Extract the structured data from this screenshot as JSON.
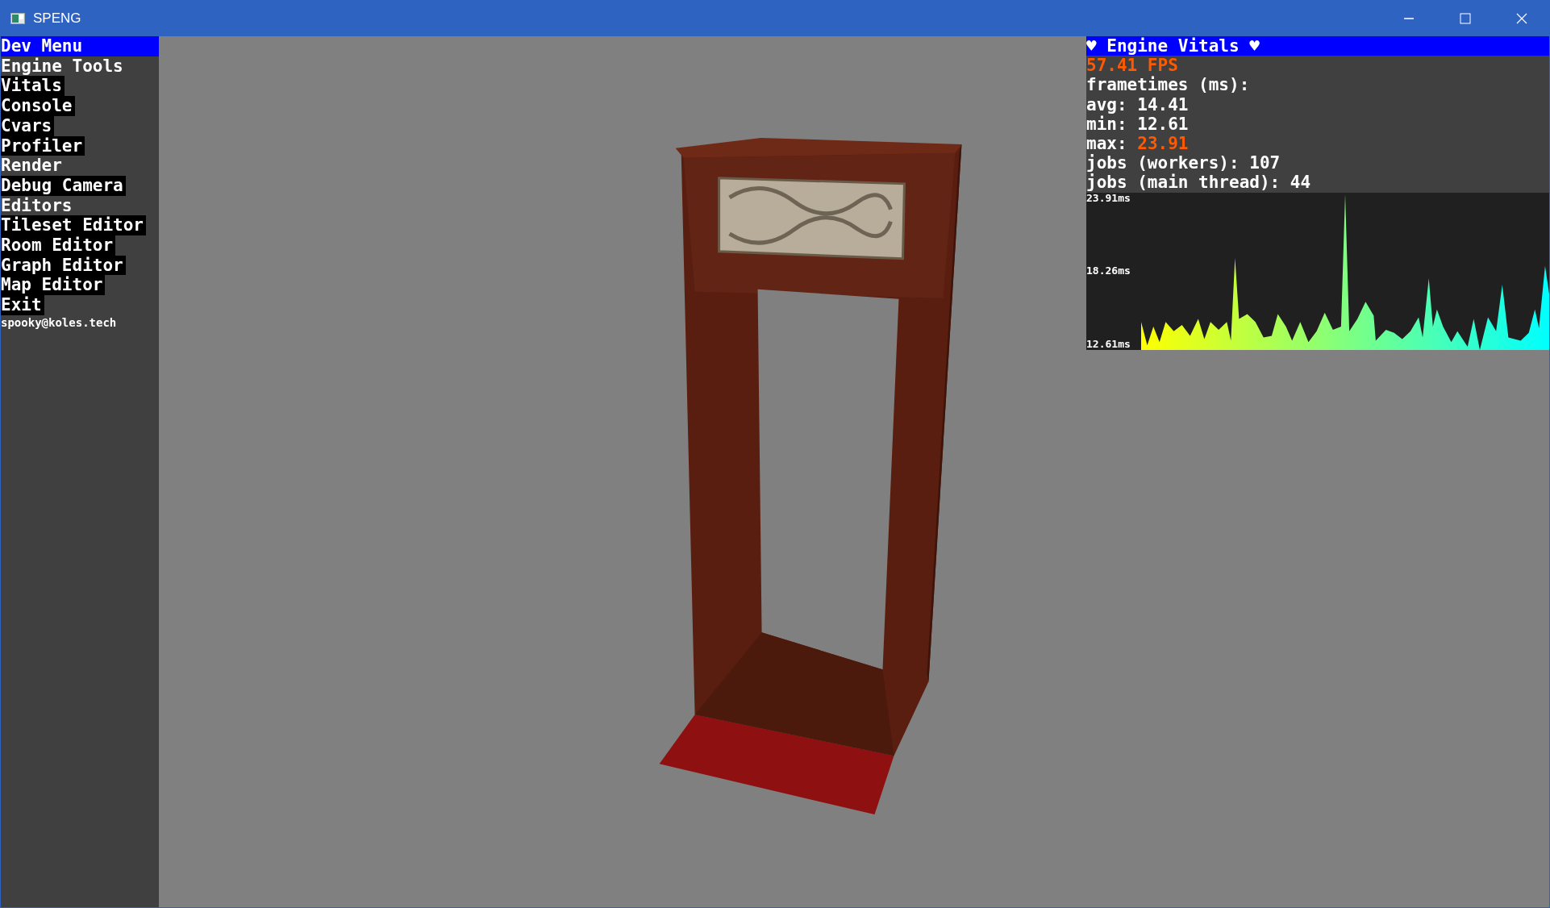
{
  "window": {
    "title": "SPENG"
  },
  "dev_menu": {
    "title": "Dev Menu",
    "items": [
      {
        "kind": "section",
        "label": "Engine Tools"
      },
      {
        "kind": "item",
        "label": "Vitals"
      },
      {
        "kind": "item",
        "label": "Console"
      },
      {
        "kind": "item",
        "label": "Cvars"
      },
      {
        "kind": "item",
        "label": "Profiler"
      },
      {
        "kind": "section",
        "label": "Render"
      },
      {
        "kind": "item",
        "label": "Debug Camera"
      },
      {
        "kind": "section",
        "label": "Editors"
      },
      {
        "kind": "item",
        "label": "Tileset Editor"
      },
      {
        "kind": "item",
        "label": "Room Editor"
      },
      {
        "kind": "item",
        "label": "Graph Editor"
      },
      {
        "kind": "item",
        "label": "Map Editor"
      },
      {
        "kind": "item",
        "label": "Exit"
      }
    ],
    "footer": "spooky@koles.tech"
  },
  "vitals": {
    "title": "♥ Engine Vitals ♥",
    "fps": "57.41 FPS",
    "frametimes_label": "frametimes (ms):",
    "stats": [
      {
        "label": "avg:",
        "value": "14.41",
        "alert": false
      },
      {
        "label": "min:",
        "value": "12.61",
        "alert": false
      },
      {
        "label": "max:",
        "value": "23.91",
        "alert": true
      }
    ],
    "jobs": [
      "jobs (workers): 107",
      "jobs (main thread): 44"
    ],
    "graph": {
      "labels": [
        "23.91ms",
        "18.26ms",
        "12.61ms"
      ]
    }
  }
}
